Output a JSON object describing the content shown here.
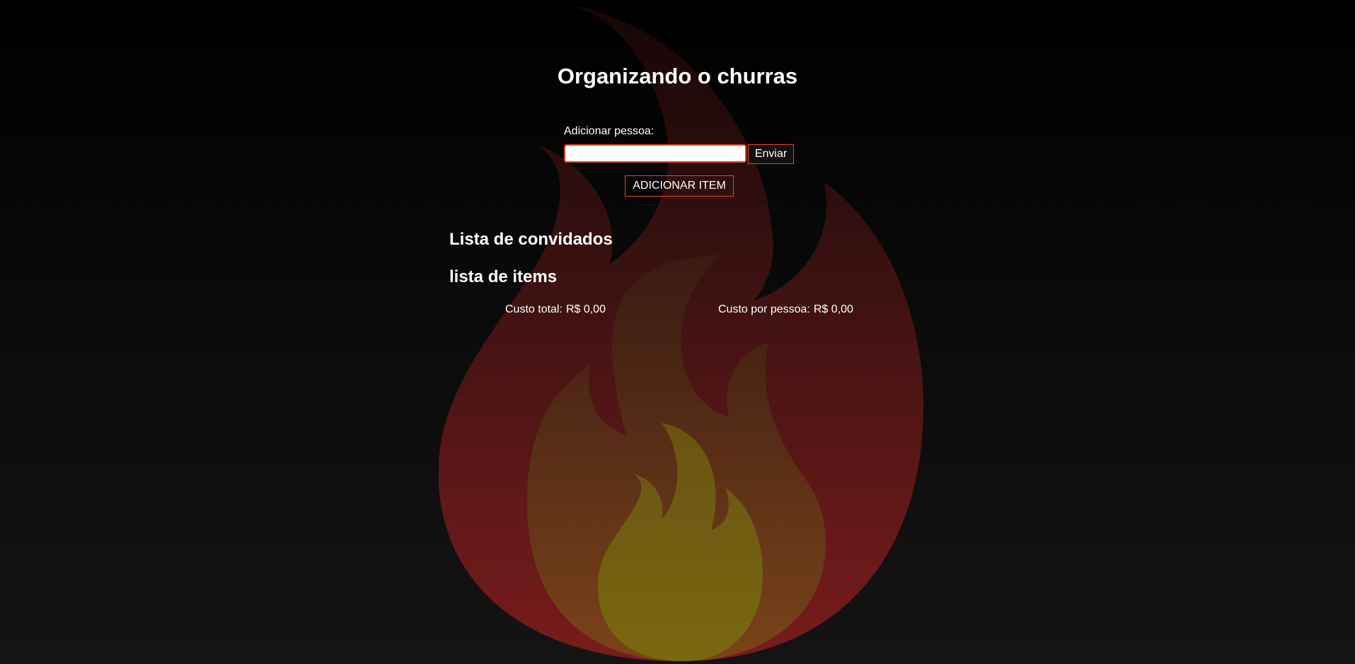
{
  "page": {
    "title": "Organizando o churras"
  },
  "form": {
    "person_label": "Adicionar pessoa:",
    "person_input_value": "",
    "send_label": "Enviar",
    "add_item_label": "ADICIONAR ITEM"
  },
  "sections": {
    "guests_title": "Lista de convidados",
    "items_title": "lista de items"
  },
  "costs": {
    "total_label": "Custo total:",
    "total_value": "R$ 0,00",
    "per_person_label": "Custo por pessoa:",
    "per_person_value": "R$ 0,00"
  },
  "colors": {
    "accent": "#e8451f",
    "background": "#0b0b0b",
    "flame_outer": "#7a1c1c",
    "flame_middle": "#7a4a1a",
    "flame_inner": "#7a6a10"
  },
  "icons": {
    "background_graphic": "fire-icon"
  },
  "guests": [],
  "items": []
}
